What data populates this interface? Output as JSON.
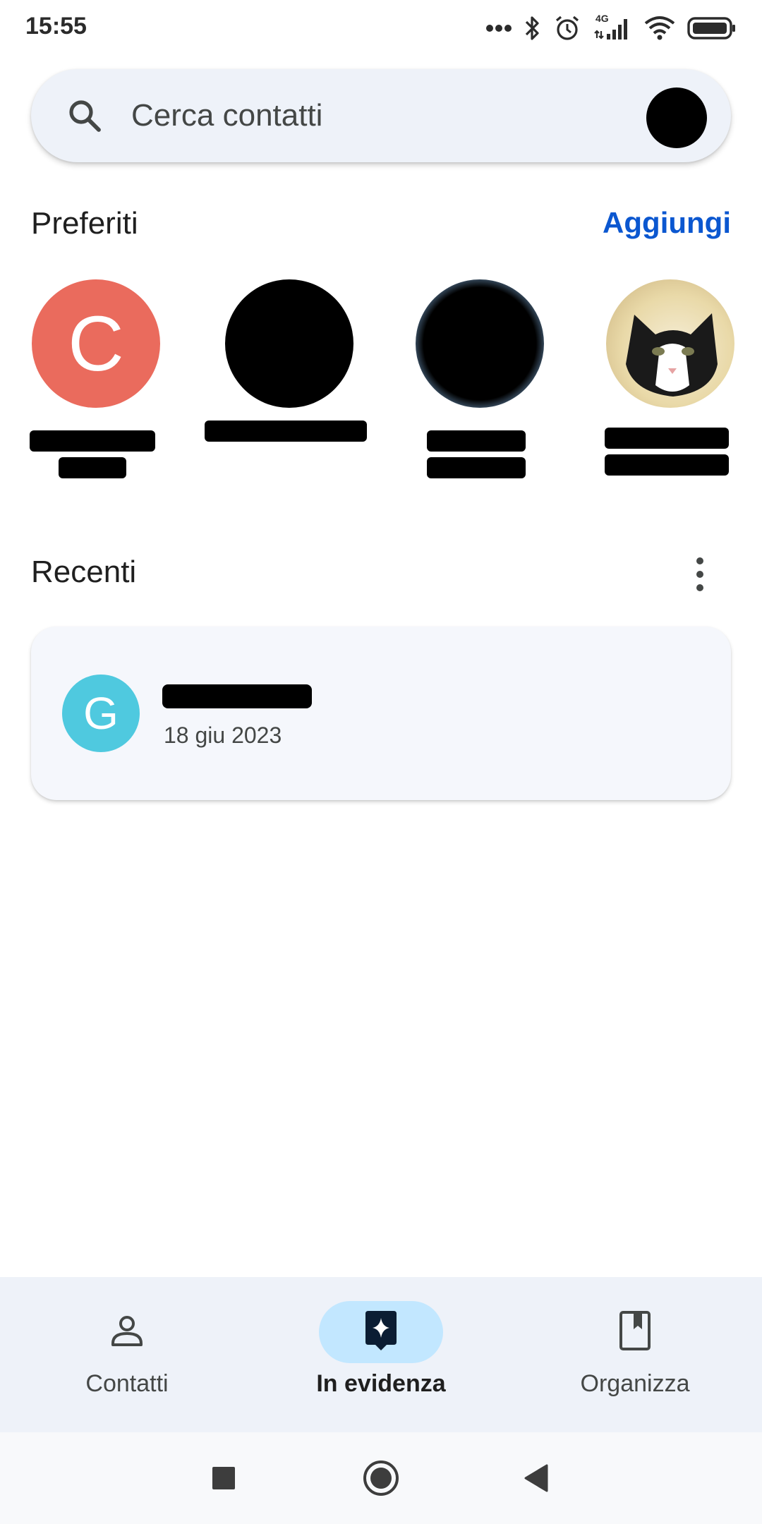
{
  "status_bar": {
    "time": "15:55",
    "network_label": "4G",
    "icons": [
      "more-dots-icon",
      "bluetooth-icon",
      "alarm-icon",
      "signal-icon",
      "wifi-icon",
      "battery-icon"
    ]
  },
  "search": {
    "placeholder": "Cerca contatti",
    "icon": "search-icon"
  },
  "favorites": {
    "title": "Preferiti",
    "add_label": "Aggiungi",
    "items": [
      {
        "avatar_letter": "C",
        "avatar_color": "#ea6b5d"
      },
      {
        "avatar_letter": ""
      },
      {
        "avatar_letter": ""
      },
      {
        "avatar_letter": ""
      }
    ]
  },
  "recent": {
    "title": "Recenti",
    "items": [
      {
        "avatar_letter": "G",
        "avatar_color": "#4fc9df",
        "date": "18 giu 2023"
      }
    ]
  },
  "bottom_nav": {
    "items": [
      {
        "label": "Contatti",
        "icon": "person-icon",
        "active": false
      },
      {
        "label": "In evidenza",
        "icon": "highlight-star-icon",
        "active": true
      },
      {
        "label": "Organizza",
        "icon": "bookmark-icon",
        "active": false
      }
    ],
    "active_pill_color": "#c2e7ff"
  },
  "colors": {
    "accent": "#0b57d0",
    "search_bg": "#eef2f9",
    "card_bg": "#f5f7fc"
  }
}
